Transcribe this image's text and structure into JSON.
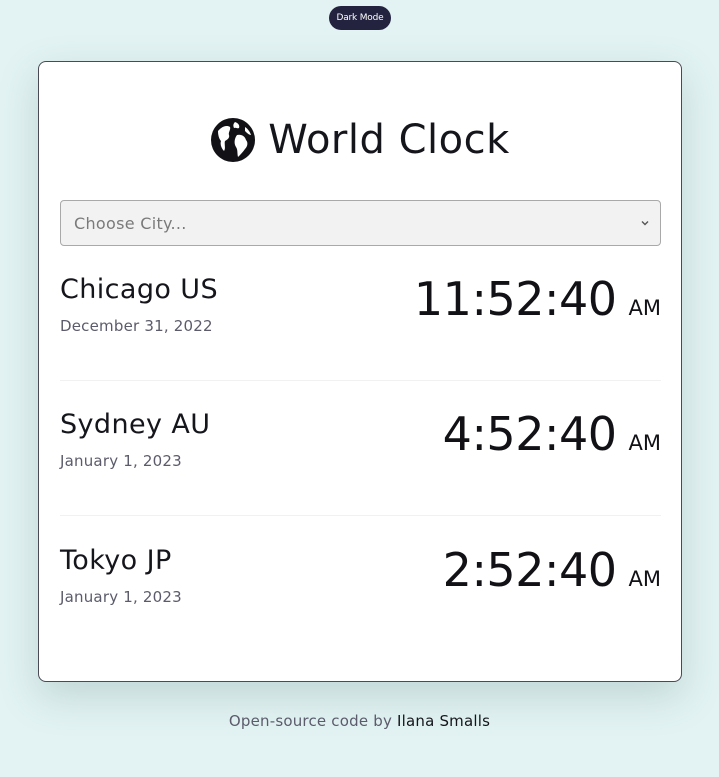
{
  "dark_mode_button": {
    "label": "Dark Mode"
  },
  "header": {
    "icon": "globe-icon",
    "title": "World Clock"
  },
  "city_select": {
    "placeholder": "Choose City..."
  },
  "clocks": [
    {
      "city": "Chicago US",
      "date": "December 31, 2022",
      "time": "11:52:40",
      "period": "AM"
    },
    {
      "city": "Sydney AU",
      "date": "January 1, 2023",
      "time": "4:52:40",
      "period": "AM"
    },
    {
      "city": "Tokyo JP",
      "date": "January 1, 2023",
      "time": "2:52:40",
      "period": "AM"
    }
  ],
  "footer": {
    "text": "Open-source code by",
    "author": "Ilana Smalls"
  },
  "colors": {
    "background": "#e3f3f3",
    "card": "#ffffff",
    "toggle": "#232340",
    "text": "#15151c",
    "muted": "#5b5b6b"
  }
}
